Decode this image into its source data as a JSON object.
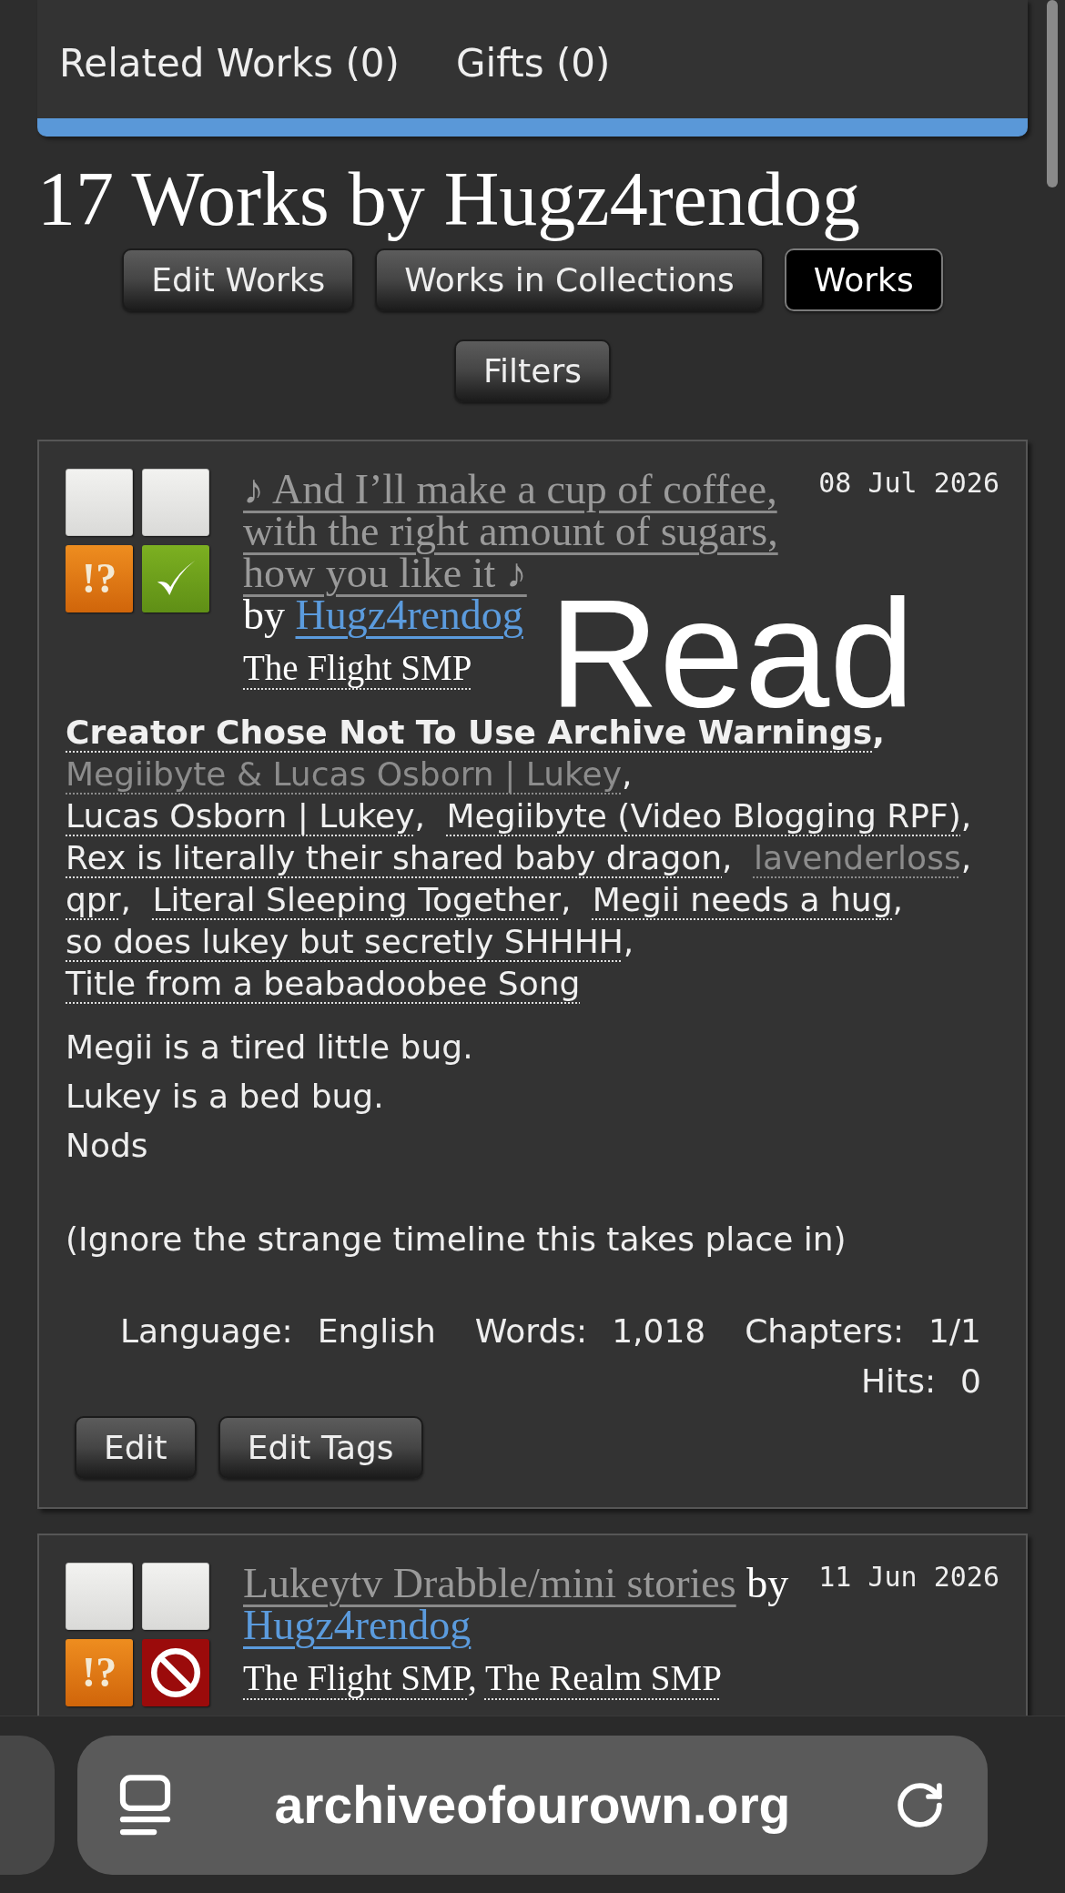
{
  "nav": [
    "Related Works (0)",
    "Gifts (0)"
  ],
  "heading": "17 Works by Hugz4rendog",
  "actions": [
    {
      "label": "Edit Works",
      "selected": false
    },
    {
      "label": "Works in Collections",
      "selected": false
    },
    {
      "label": "Works",
      "selected": true
    }
  ],
  "filters_button": "Filters",
  "separator": ",",
  "works": [
    {
      "required_tags": [
        {
          "kind": "blank"
        },
        {
          "kind": "blank"
        },
        {
          "kind": "warning",
          "symbol": "!?"
        },
        {
          "kind": "complete"
        }
      ],
      "title": "♪ And I’ll make a cup of coffee, with the right amount of sugars, how you like it ♪",
      "by": "by",
      "author": "Hugz4rendog",
      "date": "08 Jul 2026",
      "fandoms": [
        "The Flight SMP"
      ],
      "overlay_label": "Read",
      "tags": [
        {
          "text": "Creator Chose Not To Use Archive Warnings",
          "kind": "warning",
          "muted": false
        },
        {
          "text": "Megiibyte & Lucas Osborn | Lukey",
          "kind": "tag",
          "muted": true
        },
        {
          "text": "Lucas Osborn | Lukey",
          "kind": "tag",
          "muted": false
        },
        {
          "text": "Megiibyte (Video Blogging RPF)",
          "kind": "tag",
          "muted": false
        },
        {
          "text": "Rex is literally their shared baby dragon",
          "kind": "tag",
          "muted": false
        },
        {
          "text": "lavenderloss",
          "kind": "tag",
          "muted": true
        },
        {
          "text": "qpr",
          "kind": "tag",
          "muted": false
        },
        {
          "text": "Literal Sleeping Together",
          "kind": "tag",
          "muted": false
        },
        {
          "text": "Megii needs a hug",
          "kind": "tag",
          "muted": false
        },
        {
          "text": "so does lukey but secretly SHHHH",
          "kind": "tag",
          "muted": false
        },
        {
          "text": "Title from a beabadoobee Song",
          "kind": "tag",
          "muted": false
        }
      ],
      "summary": [
        "Megii is a tired little bug.\nLukey is a bed bug.\nNods",
        "(Ignore the strange timeline this takes place in)"
      ],
      "stats": [
        {
          "label": "Language:",
          "value": "English"
        },
        {
          "label": "Words:",
          "value": "1,018"
        },
        {
          "label": "Chapters:",
          "value": "1/1"
        },
        {
          "label": "Hits:",
          "value": "0"
        }
      ],
      "buttons": [
        "Edit",
        "Edit Tags"
      ]
    },
    {
      "required_tags": [
        {
          "kind": "blank"
        },
        {
          "kind": "blank"
        },
        {
          "kind": "warning",
          "symbol": "!?"
        },
        {
          "kind": "incomplete"
        }
      ],
      "title": "Lukeytv Drabble/mini stories",
      "by": "by",
      "author": "Hugz4rendog",
      "date": "11 Jun 2026",
      "fandoms": [
        "The Flight SMP",
        "The Realm SMP"
      ]
    }
  ],
  "browser_bar": {
    "url": "archiveofourown.org"
  }
}
